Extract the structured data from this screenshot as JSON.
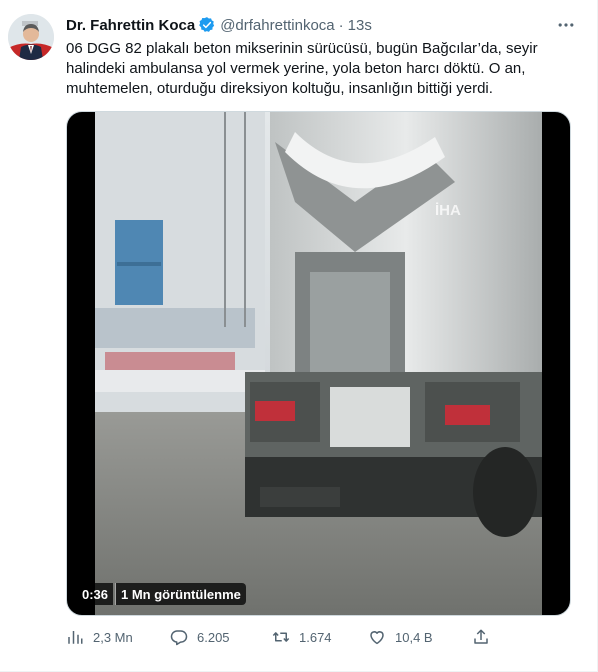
{
  "tweet": {
    "author": {
      "display_name": "Dr. Fahrettin Koca",
      "handle": "@drfahrettinkoca",
      "separator": "·",
      "time": "13s",
      "verified": true
    },
    "text_lines": [
      "06 DGG 82 plakalı beton mikserinin sürücüsü, bugün Bağcılar’da, seyir",
      "halindeki ambulansa yol vermek yerine, yola beton harcı döktü. O an,",
      "muhtemelen, oturduğu direksiyon koltuğu, insanlığın bittiği yerdi."
    ],
    "media": {
      "type": "video",
      "duration": "0:36",
      "views": "1 Mn görüntülenme",
      "watermark": "İHA"
    },
    "actions": {
      "analytics": {
        "icon": "analytics-icon",
        "count": "2,3 Mn"
      },
      "reply": {
        "icon": "reply-icon",
        "count": "6.205"
      },
      "retweet": {
        "icon": "retweet-icon",
        "count": "1.674"
      },
      "like": {
        "icon": "like-icon",
        "count": "10,4 B"
      },
      "share": {
        "icon": "share-icon"
      }
    }
  },
  "colors": {
    "text_primary": "#0f1419",
    "text_secondary": "#536471",
    "verified_blue": "#1d9bf0",
    "border": "#cfd9de"
  }
}
